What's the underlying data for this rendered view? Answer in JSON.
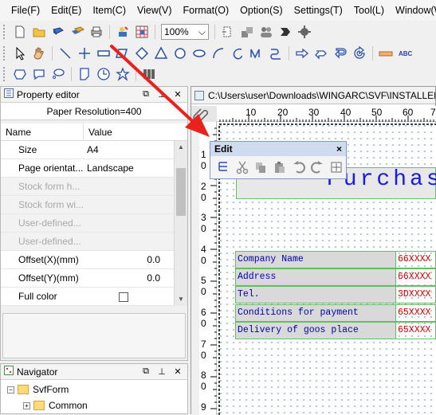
{
  "menu": [
    "File(F)",
    "Edit(E)",
    "Item(C)",
    "View(V)",
    "Format(O)",
    "Option(S)",
    "Settings(T)",
    "Tool(L)",
    "Window(W)"
  ],
  "toolbar": {
    "zoom_value": "100%",
    "abc_label": "ABC"
  },
  "property_editor": {
    "title": "Property editor",
    "paper_resolution": "Paper Resolution=400",
    "col_name": "Name",
    "col_value": "Value",
    "rows": [
      {
        "name": "Size",
        "value": "A4",
        "disabled": false
      },
      {
        "name": "Page orientat...",
        "value": "Landscape",
        "disabled": false
      },
      {
        "name": "Stock form h...",
        "value": "",
        "disabled": true
      },
      {
        "name": "Stock form wi...",
        "value": "",
        "disabled": true
      },
      {
        "name": "User-defined...",
        "value": "",
        "disabled": true
      },
      {
        "name": "User-defined...",
        "value": "",
        "disabled": true
      },
      {
        "name": "Offset(X)(mm)",
        "value": "0.0",
        "disabled": false
      },
      {
        "name": "Offset(Y)(mm)",
        "value": "0.0",
        "disabled": false
      },
      {
        "name": "Full color",
        "value": "",
        "disabled": false,
        "checkbox": true
      }
    ]
  },
  "navigator": {
    "title": "Navigator",
    "items": [
      "SvfForm",
      "Common"
    ]
  },
  "document": {
    "path": "C:\\Users\\user\\Downloads\\WINGARC\\SVF\\INSTALLER\\",
    "h_ruler": [
      "10",
      "20",
      "30",
      "40",
      "50",
      "60",
      "7"
    ],
    "v_ruler": [
      {
        "t": "1",
        "b": "0"
      },
      {
        "t": "2",
        "b": "0"
      },
      {
        "t": "3",
        "b": "0"
      },
      {
        "t": "4",
        "b": "0"
      },
      {
        "t": "5",
        "b": "0"
      },
      {
        "t": "6",
        "b": "0"
      },
      {
        "t": "7",
        "b": "0"
      },
      {
        "t": "8",
        "b": "0"
      },
      {
        "t": "9",
        "b": ""
      }
    ]
  },
  "edit_toolbar": {
    "title": "Edit",
    "close": "×"
  },
  "form": {
    "title": "Purchas",
    "fields": [
      {
        "label": "Company Name",
        "value": "66XXXX"
      },
      {
        "label": "Address",
        "value": "66XXXX"
      },
      {
        "label": "Tel.",
        "value": "3DXXXX"
      },
      {
        "label": "Conditions for payment",
        "value": "65XXXX"
      },
      {
        "label": "Delivery of goos place",
        "value": "65XXXX"
      }
    ]
  },
  "colors": {
    "annotation_arrow": "#e8221c",
    "form_text": "#1a1ae0",
    "form_value": "#e00000",
    "field_border": "#60c060"
  }
}
